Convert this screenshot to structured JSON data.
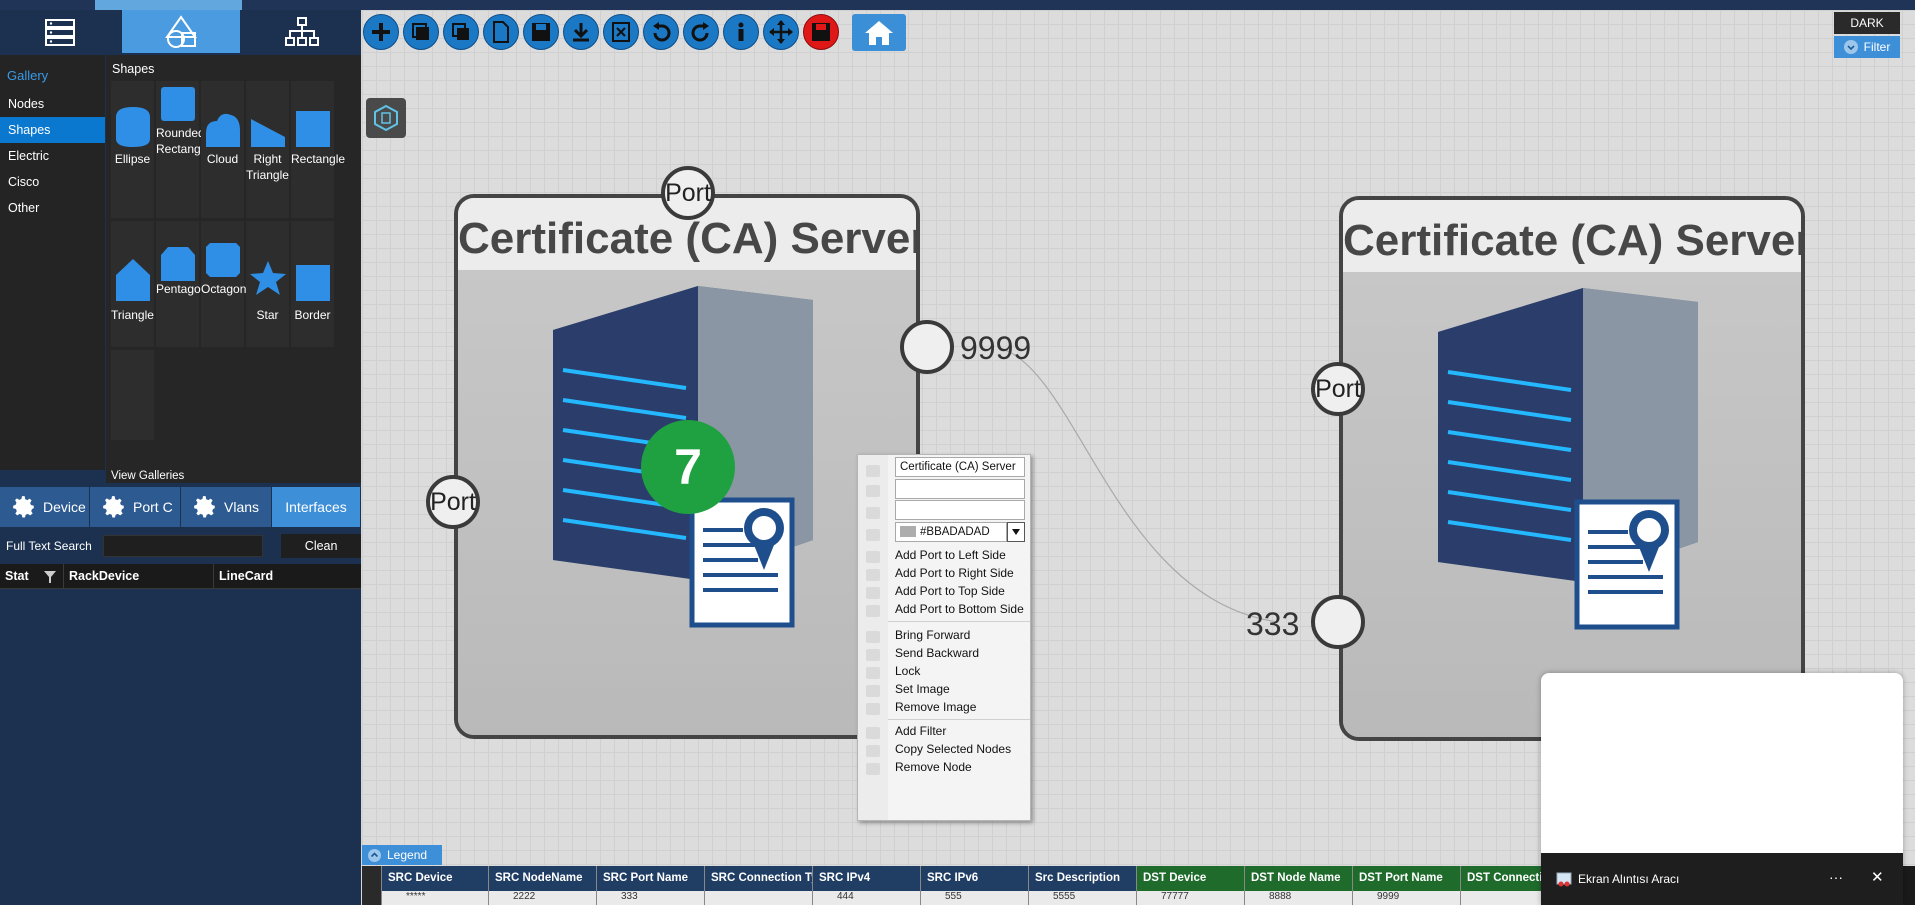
{
  "gallery": {
    "title": "Gallery",
    "nav": [
      "Nodes",
      "Shapes",
      "Electric",
      "Cisco",
      "Other"
    ],
    "selected": "Shapes",
    "shapes_title": "Shapes",
    "shapes": [
      "Ellipse",
      "Rounded Rectangle",
      "Cloud",
      "Right Triangle",
      "Rectangle",
      "Triangle",
      "Pentagon",
      "Octagon",
      "Star",
      "Border"
    ],
    "view_galleries": "View Galleries"
  },
  "bottom_tabs": [
    "Device",
    "Port C",
    "Vlans",
    "Interfaces"
  ],
  "search": {
    "label": "Full Text Search",
    "clean": "Clean"
  },
  "grid_headers": [
    "Stat",
    "RackDevice",
    "LineCard"
  ],
  "toolbar": {
    "dark": "DARK",
    "filter": "Filter"
  },
  "nodes": [
    {
      "title": "Certificate (CA) Server",
      "ports": {
        "top": "Port",
        "left": "Port"
      },
      "port_right_label": "9999"
    },
    {
      "title": "Certificate (CA) Server",
      "ports": {
        "left": "Port"
      },
      "port_left_label": "333"
    }
  ],
  "badge": "7",
  "context_menu": {
    "name_value": "Certificate (CA) Server",
    "color_value": "#BBADADAD",
    "items": [
      "Add Port to Left Side",
      "Add Port to Right Side",
      "Add Port to Top Side",
      "Add Port to Bottom Side",
      "Bring Forward",
      "Send Backward",
      "Lock",
      "Set Image",
      "Remove Image",
      "Add Filter",
      "Copy Selected Nodes",
      "Remove Node"
    ]
  },
  "legend": "Legend",
  "table_headers": [
    "SRC Device",
    "SRC NodeName",
    "SRC Port Name",
    "SRC Connection Typ",
    "SRC IPv4",
    "SRC IPv6",
    "Src Description",
    "DST Device",
    "DST Node Name",
    "DST Port Name",
    "DST Connecti"
  ],
  "table_row": [
    "*****",
    "2222",
    "333",
    "",
    "444",
    "555",
    "5555",
    "77777",
    "8888",
    "9999",
    ""
  ],
  "snip_tool": {
    "title": "Ekran Alıntısı Aracı",
    "more": "···",
    "close": "✕"
  },
  "colors": {
    "accent": "#3d8fd8",
    "toolbar_blue": "#1b78c4",
    "badge_green": "#1fa141",
    "dst_header": "#1e6b2c",
    "src_header": "#203d63"
  }
}
